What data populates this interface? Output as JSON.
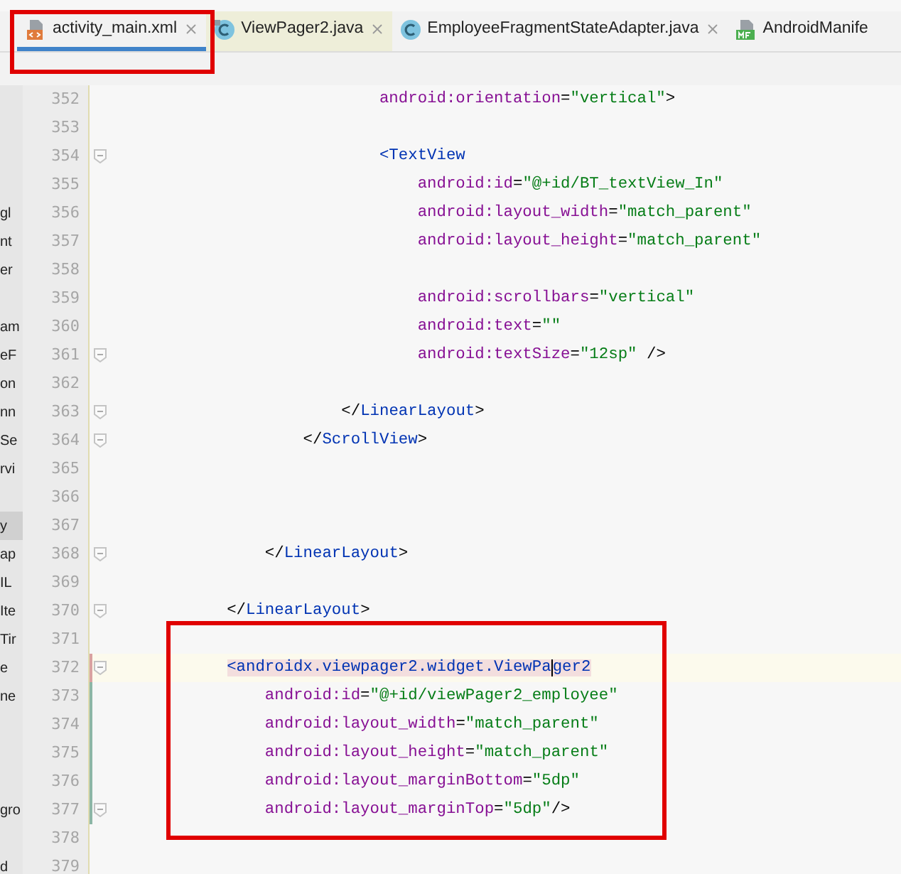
{
  "tabs": [
    {
      "label": "activity_main.xml",
      "kind": "xml",
      "selected": true
    },
    {
      "label": "ViewPager2.java",
      "kind": "class_library",
      "selected": false,
      "color": "#eeeed9"
    },
    {
      "label": "EmployeeFragmentStateAdapter.java",
      "kind": "class",
      "selected": false
    },
    {
      "label": "AndroidManife",
      "kind": "manifest",
      "selected": false
    }
  ],
  "project_panel": {
    "items": [
      {
        "selected": false
      },
      {
        "selected": false
      },
      {
        "selected": false
      },
      {
        "selected": false
      },
      {
        "text": "gl",
        "selected": false
      },
      {
        "text": "nt",
        "selected": false
      },
      {
        "text": "er",
        "selected": false
      },
      {
        "selected": false
      },
      {
        "text": "am",
        "selected": false
      },
      {
        "text": "eF",
        "selected": false
      },
      {
        "text": "on",
        "selected": false
      },
      {
        "text": "nn",
        "selected": false
      },
      {
        "text": "Se",
        "selected": false
      },
      {
        "text": "rvi",
        "selected": false
      },
      {
        "selected": false
      },
      {
        "text": "y",
        "selected": true
      },
      {
        "text": "ap",
        "selected": false
      },
      {
        "text": "IL",
        "selected": false
      },
      {
        "text": "Ite",
        "selected": false
      },
      {
        "text": "Tir",
        "selected": false
      },
      {
        "text": "e",
        "selected": false
      },
      {
        "text": "ne",
        "selected": false
      },
      {
        "selected": false
      },
      {
        "selected": false
      },
      {
        "selected": false
      },
      {
        "text": "gro",
        "selected": false
      },
      {
        "selected": false
      },
      {
        "text": "d",
        "selected": false
      }
    ]
  },
  "editor": {
    "lines": [
      {
        "number": "352",
        "tokens": [
          {
            "kind": "attr",
            "text": "                            android:orientation"
          },
          {
            "kind": "punct",
            "text": "="
          },
          {
            "kind": "value",
            "text": "\"vertical\""
          },
          {
            "kind": "punct",
            "text": ">"
          }
        ]
      },
      {
        "number": "353"
      },
      {
        "number": "354",
        "fold": true,
        "tokens": [
          {
            "kind": "tag",
            "text": "                            <TextView"
          }
        ]
      },
      {
        "number": "355",
        "tokens": [
          {
            "kind": "attr",
            "text": "                                android:id"
          },
          {
            "kind": "punct",
            "text": "="
          },
          {
            "kind": "value",
            "text": "\"@+id/BT_textView_In\""
          }
        ]
      },
      {
        "number": "356",
        "tokens": [
          {
            "kind": "attr",
            "text": "                                android:layout_width"
          },
          {
            "kind": "punct",
            "text": "="
          },
          {
            "kind": "value",
            "text": "\"match_parent\""
          }
        ]
      },
      {
        "number": "357",
        "tokens": [
          {
            "kind": "attr",
            "text": "                                android:layout_height"
          },
          {
            "kind": "punct",
            "text": "="
          },
          {
            "kind": "value",
            "text": "\"match_parent\""
          }
        ]
      },
      {
        "number": "358"
      },
      {
        "number": "359",
        "tokens": [
          {
            "kind": "attr",
            "text": "                                android:scrollbars"
          },
          {
            "kind": "punct",
            "text": "="
          },
          {
            "kind": "value",
            "text": "\"vertical\""
          }
        ]
      },
      {
        "number": "360",
        "tokens": [
          {
            "kind": "attr",
            "text": "                                android:text"
          },
          {
            "kind": "punct",
            "text": "="
          },
          {
            "kind": "value",
            "text": "\"\""
          }
        ]
      },
      {
        "number": "361",
        "fold": true,
        "tokens": [
          {
            "kind": "attr",
            "text": "                                android:textSize"
          },
          {
            "kind": "punct",
            "text": "="
          },
          {
            "kind": "value",
            "text": "\"12sp\""
          },
          {
            "kind": "punct",
            "text": " />"
          }
        ]
      },
      {
        "number": "362"
      },
      {
        "number": "363",
        "fold": true,
        "tokens": [
          {
            "kind": "punct",
            "text": "                        </"
          },
          {
            "kind": "tag",
            "text": "LinearLayout"
          },
          {
            "kind": "punct",
            "text": ">"
          }
        ]
      },
      {
        "number": "364",
        "fold": true,
        "tokens": [
          {
            "kind": "punct",
            "text": "                    </"
          },
          {
            "kind": "tag",
            "text": "ScrollView"
          },
          {
            "kind": "punct",
            "text": ">"
          }
        ]
      },
      {
        "number": "365"
      },
      {
        "number": "366"
      },
      {
        "number": "367"
      },
      {
        "number": "368",
        "fold": true,
        "tokens": [
          {
            "kind": "punct",
            "text": "                </"
          },
          {
            "kind": "tag",
            "text": "LinearLayout"
          },
          {
            "kind": "punct",
            "text": ">"
          }
        ]
      },
      {
        "number": "369"
      },
      {
        "number": "370",
        "fold": true,
        "tokens": [
          {
            "kind": "punct",
            "text": "            </"
          },
          {
            "kind": "tag",
            "text": "LinearLayout"
          },
          {
            "kind": "punct",
            "text": ">"
          }
        ]
      },
      {
        "number": "371"
      },
      {
        "number": "372",
        "fold": true,
        "current": true,
        "color": "#d9a1a1",
        "tokens": [
          {
            "kind": "tag",
            "text": "            <androidx.viewpager2.widget.ViewPa",
            "matched": true,
            "caret_after": true
          },
          {
            "kind": "tag",
            "text": "ger2",
            "matched": true
          }
        ]
      },
      {
        "number": "373",
        "color": "#8cb6a6",
        "tokens": [
          {
            "kind": "attr",
            "text": "                android:id"
          },
          {
            "kind": "punct",
            "text": "="
          },
          {
            "kind": "value",
            "text": "\"@+id/viewPager2_employee\""
          }
        ]
      },
      {
        "number": "374",
        "color": "#8cb6a6",
        "tokens": [
          {
            "kind": "attr",
            "text": "                android:layout_width"
          },
          {
            "kind": "punct",
            "text": "="
          },
          {
            "kind": "value",
            "text": "\"match_parent\""
          }
        ]
      },
      {
        "number": "375",
        "color": "#8cb6a6",
        "tokens": [
          {
            "kind": "attr",
            "text": "                android:layout_height"
          },
          {
            "kind": "punct",
            "text": "="
          },
          {
            "kind": "value",
            "text": "\"match_parent\""
          }
        ]
      },
      {
        "number": "376",
        "color": "#8cb6a6",
        "tokens": [
          {
            "kind": "attr",
            "text": "                android:layout_marginBottom"
          },
          {
            "kind": "punct",
            "text": "="
          },
          {
            "kind": "value",
            "text": "\"5dp\""
          }
        ]
      },
      {
        "number": "377",
        "fold": true,
        "color": "#8cb6a6",
        "tokens": [
          {
            "kind": "attr",
            "text": "                android:layout_marginTop"
          },
          {
            "kind": "punct",
            "text": "="
          },
          {
            "kind": "value",
            "text": "\"5dp\""
          },
          {
            "kind": "punct",
            "text": "/>"
          }
        ]
      },
      {
        "number": "378"
      },
      {
        "number": "379"
      }
    ]
  }
}
